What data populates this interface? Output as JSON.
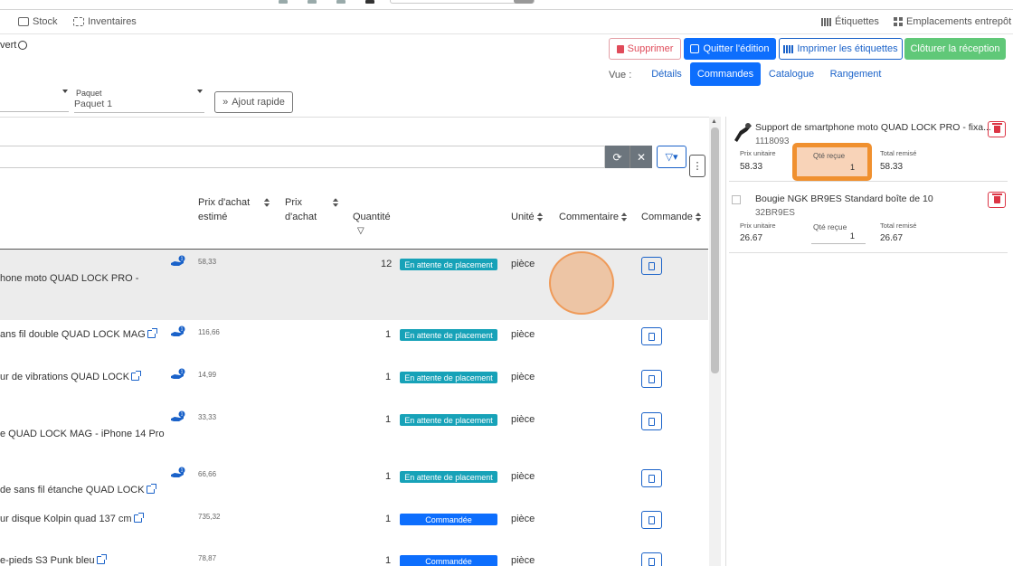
{
  "nav": {
    "stock": "Stock",
    "inventaires": "Inventaires",
    "etiquettes": "Étiquettes",
    "emplacements": "Emplacements entrepôt"
  },
  "header": {
    "title_fragment": "vert",
    "buttons": {
      "supprimer": "Supprimer",
      "quitter": "Quitter l'édition",
      "imprimer": "Imprimer les étiquettes",
      "cloturer": "Clôturer la réception"
    },
    "vue_label": "Vue :",
    "view_tabs": [
      "Détails",
      "Commandes",
      "Catalogue",
      "Rangement"
    ],
    "active_tab": "Commandes"
  },
  "form": {
    "paquet_label": "Paquet",
    "paquet_value": "Paquet 1",
    "quick_add": "Ajout rapide"
  },
  "table": {
    "headers": {
      "prix_estime": [
        "Prix d'achat",
        "estimé"
      ],
      "prix_achat": [
        "Prix",
        "d'achat"
      ],
      "quantite": "Quantité",
      "unite": "Unité",
      "commentaire": "Commentaire",
      "commande": "Commande"
    },
    "rows": [
      {
        "name": "hone moto QUAD LOCK PRO -",
        "price": "58,33",
        "qty": "12",
        "status": "En attente de placement",
        "unit": "pièce",
        "link": false
      },
      {
        "name": "ans fil double QUAD LOCK MAG",
        "price": "116,66",
        "qty": "1",
        "status": "En attente de placement",
        "unit": "pièce",
        "link": true
      },
      {
        "name": "ur de vibrations QUAD LOCK",
        "price": "14,99",
        "qty": "1",
        "status": "En attente de placement",
        "unit": "pièce",
        "link": true
      },
      {
        "name": "e QUAD LOCK MAG - iPhone 14 Pro",
        "price": "33,33",
        "qty": "1",
        "status": "En attente de placement",
        "unit": "pièce",
        "link": false
      },
      {
        "name": "de sans fil étanche QUAD LOCK",
        "price": "66,66",
        "qty": "1",
        "status": "En attente de placement",
        "unit": "pièce",
        "link": true
      },
      {
        "name": "ur disque Kolpin quad 137 cm",
        "price": "735,32",
        "qty": "1",
        "status": "Commandée",
        "unit": "pièce",
        "link": true
      },
      {
        "name": "e-pieds S3 Punk bleu",
        "price": "78,87",
        "qty": "1",
        "status": "Commandée",
        "unit": "pièce",
        "link": true
      }
    ],
    "hand_badge": "1"
  },
  "side": {
    "items": [
      {
        "title": "Support de smartphone moto QUAD LOCK PRO - fixa...",
        "ref": "1118093",
        "prix_label": "Prix unitaire",
        "prix": "58.33",
        "qte_label": "Qté reçue",
        "qte": "1",
        "total_label": "Total remisé",
        "total": "58.33"
      },
      {
        "title": "Bougie NGK BR9ES Standard boîte de 10",
        "ref": "32BR9ES",
        "prix_label": "Prix unitaire",
        "prix": "26.67",
        "qte_label": "Qté reçue",
        "qte": "1",
        "total_label": "Total remisé",
        "total": "26.67"
      }
    ]
  },
  "colors": {
    "primary": "#0d6efd",
    "info": "#17a2b8",
    "success": "#60c878",
    "danger": "#dc3545",
    "highlight": "#f0902f"
  }
}
